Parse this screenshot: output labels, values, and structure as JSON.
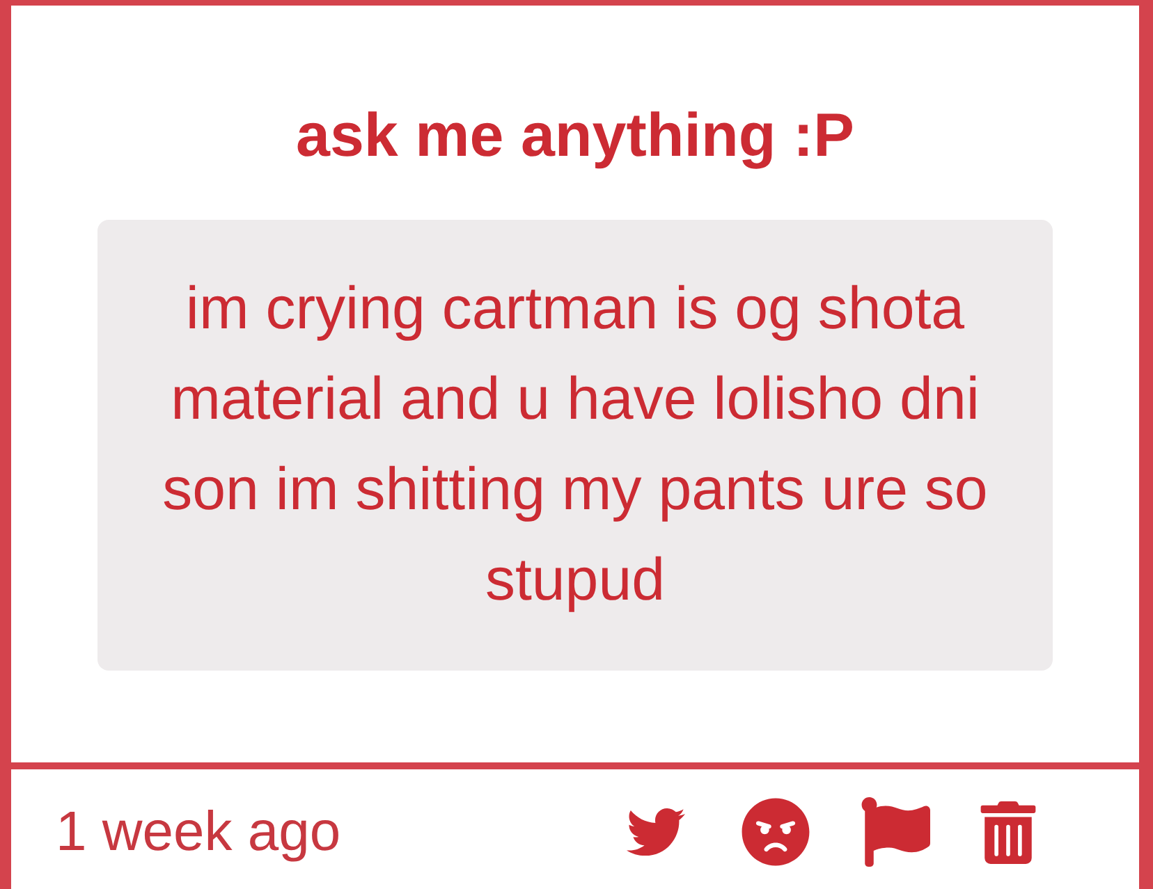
{
  "card": {
    "title": "ask me anything :P",
    "question": "im crying cartman is og shota material and u have lolisho dni son im shitting my pants ure so stupud"
  },
  "footer": {
    "time": "1 week ago",
    "actions": [
      {
        "kind": "share"
      },
      {
        "kind": "react"
      },
      {
        "kind": "report"
      },
      {
        "kind": "delete"
      }
    ]
  }
}
